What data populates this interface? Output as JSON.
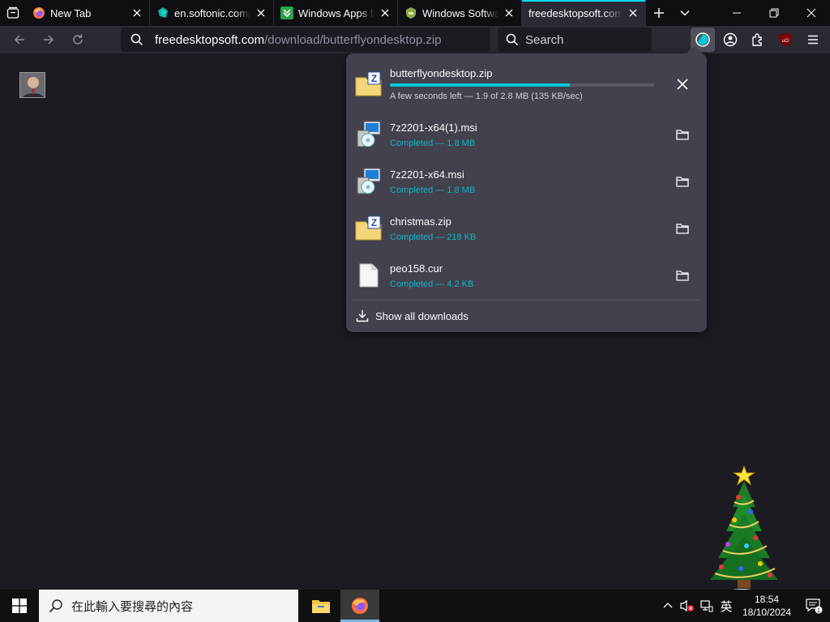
{
  "tabs": [
    {
      "title": "New Tab",
      "favicon": "firefox-icon",
      "active": false
    },
    {
      "title": "en.softonic.com/download",
      "favicon": "softonic-icon",
      "active": false
    },
    {
      "title": "Windows Apps for PC",
      "favicon": "windows-apps-icon",
      "active": false
    },
    {
      "title": "Windows Software",
      "favicon": "windows-software-icon",
      "active": false
    },
    {
      "title": "freedesktopsoft.com/download",
      "favicon": "none",
      "active": true
    }
  ],
  "urlbar": {
    "host": "freedesktopsoft.com",
    "path": "/download/butterflyondesktop.zip"
  },
  "searchbar": {
    "placeholder": "Search"
  },
  "downloads": {
    "items": [
      {
        "name": "butterflyondesktop.zip",
        "status": "A few seconds left — 1.9 of 2.8 MB (135 KB/sec)",
        "progress": 0.68,
        "icon": "zip-icon",
        "in_progress": true
      },
      {
        "name": "7z2201-x64(1).msi",
        "status": "Completed — 1.8 MB",
        "icon": "msi-installer-icon",
        "in_progress": false
      },
      {
        "name": "7z2201-x64.msi",
        "status": "Completed — 1.8 MB",
        "icon": "msi-installer-icon",
        "in_progress": false
      },
      {
        "name": "christmas.zip",
        "status": "Completed — 218 KB",
        "icon": "zip-icon",
        "in_progress": false
      },
      {
        "name": "peo158.cur",
        "status": "Completed — 4.2 KB",
        "icon": "file-icon",
        "in_progress": false
      }
    ],
    "show_all_label": "Show all downloads"
  },
  "taskbar": {
    "search_placeholder": "在此輸入要搜尋的內容",
    "ime_label": "英",
    "time": "18:54",
    "date": "18/10/2024",
    "notification_count": "1"
  },
  "colors": {
    "accent": "#00ddff",
    "progress": "#00c8d7",
    "completed_text": "#0fb5c6"
  }
}
